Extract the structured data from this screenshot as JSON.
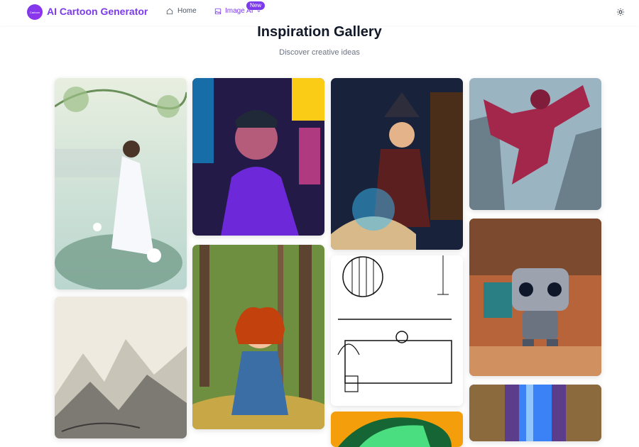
{
  "header": {
    "logo_text": "Cartoon",
    "brand": "AI Cartoon Generator",
    "nav": [
      {
        "label": "Home",
        "icon": "home-icon"
      },
      {
        "label": "Image AI",
        "icon": "image-icon",
        "badge": "New"
      }
    ],
    "theme_icon": "sun-icon"
  },
  "gallery": {
    "title": "Inspiration Gallery",
    "subtitle": "Discover creative ideas",
    "images": [
      {
        "subject": "watercolor-girl-lotus"
      },
      {
        "subject": "neon-city-man"
      },
      {
        "subject": "wizard-magic-book"
      },
      {
        "subject": "flying-superhero"
      },
      {
        "subject": "ink-mountain-landscape"
      },
      {
        "subject": "girl-in-forest"
      },
      {
        "subject": "line-art-cafe"
      },
      {
        "subject": "robot-toy"
      },
      {
        "subject": "colorful-abstract"
      },
      {
        "subject": "pixel-waterfall"
      }
    ]
  },
  "colors": {
    "accent": "#7c3aed",
    "text": "#111827",
    "muted": "#6b7280"
  }
}
